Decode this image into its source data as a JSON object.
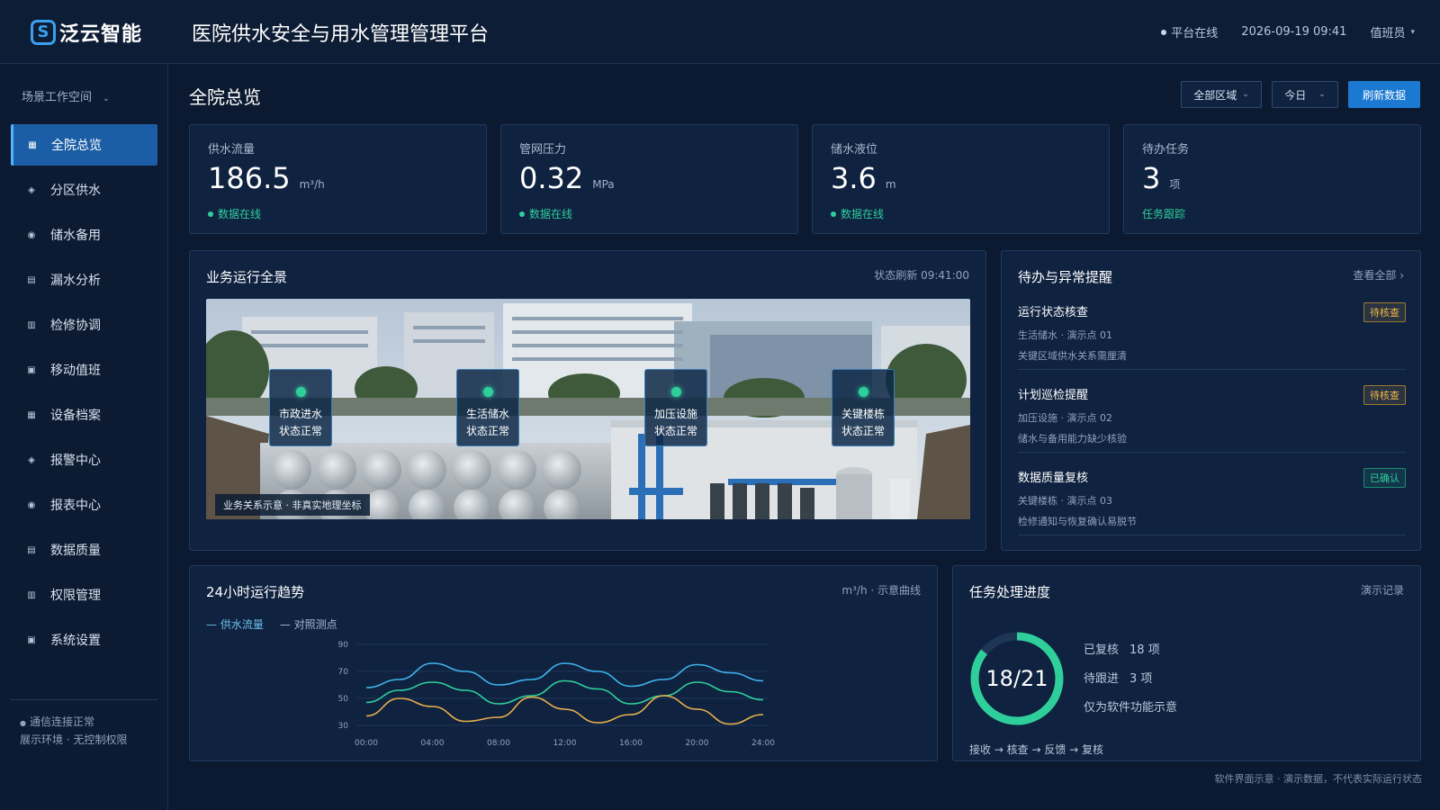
{
  "header": {
    "brand": "泛云智能",
    "title": "医院供水安全与用水管理管理平台",
    "status": "平台在线",
    "datetime": "2026-09-19 09:41",
    "user": "值班员"
  },
  "sidebar": {
    "workspace": "场景工作空间",
    "items": [
      {
        "label": "全院总览",
        "active": true
      },
      {
        "label": "分区供水"
      },
      {
        "label": "储水备用"
      },
      {
        "label": "漏水分析"
      },
      {
        "label": "检修协调"
      },
      {
        "label": "移动值班"
      },
      {
        "label": "设备档案"
      },
      {
        "label": "报警中心"
      },
      {
        "label": "报表中心"
      },
      {
        "label": "数据质量"
      },
      {
        "label": "权限管理"
      },
      {
        "label": "系统设置"
      }
    ],
    "footer_line1": "通信连接正常",
    "footer_line2": "展示环境 · 无控制权限"
  },
  "main": {
    "page_title": "全院总览",
    "filter_region": "全部区域",
    "filter_time": "今日",
    "refresh_label": "刷新数据"
  },
  "kpis": [
    {
      "label": "供水流量",
      "value": "186.5",
      "unit": "m³/h",
      "status": "数据在线",
      "status_type": "online"
    },
    {
      "label": "管网压力",
      "value": "0.32",
      "unit": "MPa",
      "status": "数据在线",
      "status_type": "online"
    },
    {
      "label": "储水液位",
      "value": "3.6",
      "unit": "m",
      "status": "数据在线",
      "status_type": "online"
    },
    {
      "label": "待办任务",
      "value": "3",
      "unit": "项",
      "status": "任务跟踪",
      "status_type": "link"
    }
  ],
  "overview": {
    "title": "业务运行全景",
    "refresh": "状态刷新 09:41:00",
    "nodes": [
      {
        "name": "市政进水",
        "state": "状态正常"
      },
      {
        "name": "生活储水",
        "state": "状态正常"
      },
      {
        "name": "加压设施",
        "state": "状态正常"
      },
      {
        "name": "关键楼栋",
        "state": "状态正常"
      }
    ],
    "caption": "业务关系示意 · 非真实地理坐标"
  },
  "alerts": {
    "title": "待办与异常提醒",
    "view_all": "查看全部 ›",
    "items": [
      {
        "title": "运行状态核查",
        "sub": "生活储水 · 演示点 01",
        "desc": "关键区域供水关系需厘清",
        "badge": "待核查",
        "badge_type": "warn"
      },
      {
        "title": "计划巡检提醒",
        "sub": "加压设施 · 演示点 02",
        "desc": "储水与备用能力缺少核验",
        "badge": "待核查",
        "badge_type": "warn"
      },
      {
        "title": "数据质量复核",
        "sub": "关键楼栋 · 演示点 03",
        "desc": "检修通知与恢复确认易脱节",
        "badge": "已确认",
        "badge_type": "ok"
      }
    ]
  },
  "trend": {
    "title": "24小时运行趋势",
    "meta": "m³/h · 示意曲线",
    "legend1": "— 供水流量",
    "legend2": "— 对照测点"
  },
  "chart_data": {
    "type": "line",
    "x": [
      "00:00",
      "02:00",
      "04:00",
      "06:00",
      "08:00",
      "10:00",
      "12:00",
      "14:00",
      "16:00",
      "18:00",
      "20:00",
      "22:00",
      "24:00"
    ],
    "x_ticks": [
      "00:00",
      "04:00",
      "08:00",
      "12:00",
      "16:00",
      "20:00",
      "24:00"
    ],
    "y_ticks": [
      90,
      70,
      50,
      30
    ],
    "ylim": [
      30,
      90
    ],
    "series": [
      {
        "name": "供水流量",
        "color": "#3fb3ea",
        "values": [
          58,
          64,
          76,
          70,
          60,
          64,
          76,
          70,
          59,
          64,
          75,
          69,
          63
        ]
      },
      {
        "name": "对照测点",
        "color": "#2fcf9c",
        "values": [
          47,
          56,
          62,
          56,
          46,
          52,
          63,
          57,
          46,
          52,
          62,
          55,
          49
        ]
      },
      {
        "color": "#e8b04b",
        "values": [
          37,
          50,
          44,
          33,
          36,
          51,
          42,
          32,
          38,
          52,
          42,
          31,
          38
        ]
      }
    ],
    "grid": true
  },
  "progress": {
    "title": "任务处理进度",
    "meta": "演示记录",
    "done": 18,
    "total": 21,
    "center_label": "18/21",
    "row1_label": "已复核",
    "row1_value": "18 项",
    "row2_label": "待跟进",
    "row2_value": "3 项",
    "row3": "仅为软件功能示意",
    "flow": "接收 → 核查 → 反馈 → 复核"
  },
  "footnote": "软件界面示意 · 演示数据，不代表实际运行状态",
  "colors": {
    "accent": "#1b79d2",
    "online": "#2fcf9c",
    "warn": "#f0b94a",
    "bg": "#0b1a30"
  }
}
